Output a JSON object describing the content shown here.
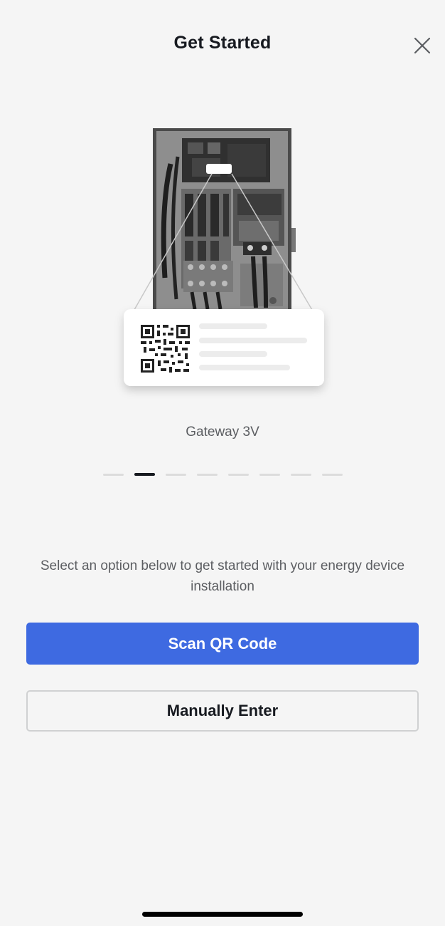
{
  "header": {
    "title": "Get Started",
    "close_icon": "close-icon"
  },
  "carousel": {
    "device_name": "Gateway 3V",
    "page_count": 8,
    "active_index": 1
  },
  "main": {
    "description": "Select an option below to get started with your energy device installation"
  },
  "actions": {
    "scan_label": "Scan QR Code",
    "manual_label": "Manually Enter"
  },
  "colors": {
    "primary": "#3e6ae1",
    "background": "#f5f5f5",
    "text": "#171a20",
    "secondary_text": "#5c5e62"
  }
}
